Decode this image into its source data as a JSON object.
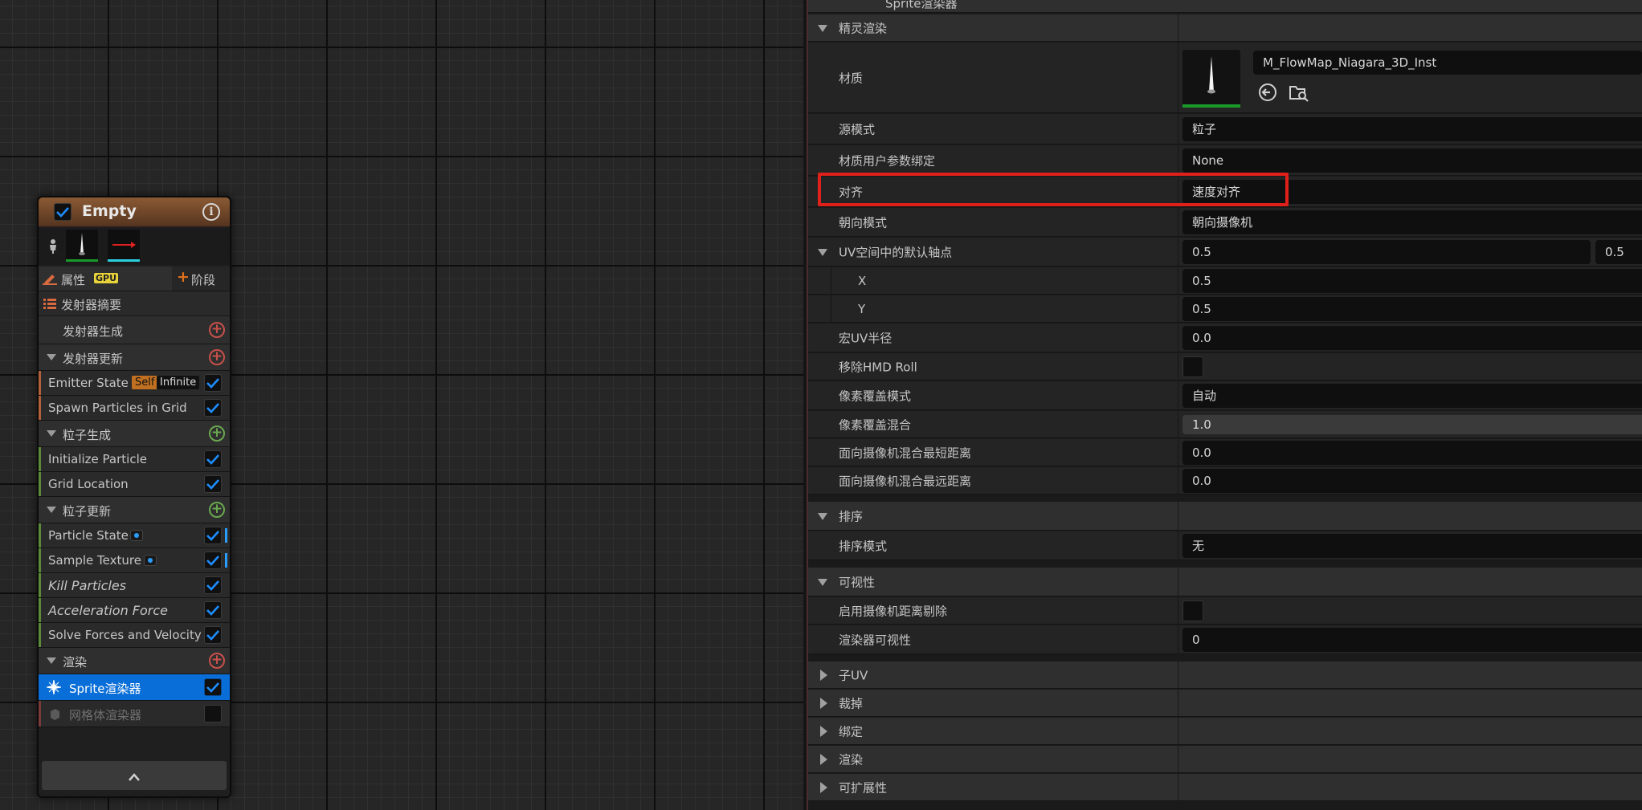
{
  "panel_header": {
    "title": "Sprite渲染器"
  },
  "node": {
    "title": "Empty",
    "properties_label": "属性",
    "gpu_badge": "GPU",
    "stage_button": "阶段",
    "summary_label": "发射器摘要",
    "emitter_spawn": "发射器生成",
    "emitter_update": "发射器更新",
    "emitter_state": {
      "label": "Emitter State",
      "tag_self": "Self",
      "tag_infinite": "Infinite"
    },
    "spawn_particles_in_grid": "Spawn Particles in Grid",
    "particle_spawn": "粒子生成",
    "initialize_particle": "Initialize Particle",
    "grid_location": "Grid Location",
    "particle_update": "粒子更新",
    "particle_state": "Particle State",
    "sample_texture": "Sample Texture",
    "kill_particles": "Kill Particles",
    "acceleration_force": "Acceleration Force",
    "solve_forces": "Solve Forces and Velocity",
    "render": "渲染",
    "sprite_renderer": "Sprite渲染器",
    "mesh_renderer": "网格体渲染器",
    "collapse_icon": "chevron-up-icon"
  },
  "details": {
    "sprite_rendering": "精灵渲染",
    "material_label": "材质",
    "material_value": "M_FlowMap_Niagara_3D_Inst",
    "source_mode_label": "源模式",
    "source_mode_value": "粒子",
    "material_param_binding_label": "材质用户参数绑定",
    "material_param_binding_value": "None",
    "alignment_label": "对齐",
    "alignment_value": "速度对齐",
    "facing_mode_label": "朝向模式",
    "facing_mode_value": "朝向摄像机",
    "pivot_label": "UV空间中的默认轴点",
    "pivot_value_x": "0.5",
    "pivot_value_y": "0.5",
    "x_label": "X",
    "x_value": "0.5",
    "y_label": "Y",
    "y_value": "0.5",
    "macro_uv_label": "宏UV半径",
    "macro_uv_value": "0.0",
    "remove_hmd_roll_label": "移除HMD Roll",
    "pixel_coverage_mode_label": "像素覆盖模式",
    "pixel_coverage_mode_value": "自动",
    "pixel_coverage_blend_label": "像素覆盖混合",
    "pixel_coverage_blend_value": "1.0",
    "min_face_cam_label": "面向摄像机混合最短距离",
    "min_face_cam_value": "0.0",
    "max_face_cam_label": "面向摄像机混合最远距离",
    "max_face_cam_value": "0.0",
    "sorting": "排序",
    "sort_mode_label": "排序模式",
    "sort_mode_value": "无",
    "visibility": "可视性",
    "camera_distance_culling_label": "启用摄像机距离剔除",
    "renderer_visibility_label": "渲染器可视性",
    "renderer_visibility_value": "0",
    "sub_uv": "子UV",
    "cutout": "裁掉",
    "bindings": "绑定",
    "rendering": "渲染",
    "scalability": "可扩展性"
  },
  "colors": {
    "highlight_box": "#e0201a",
    "selection_blue": "#0a6ed8",
    "checkbox_blue": "#1d8dff"
  }
}
